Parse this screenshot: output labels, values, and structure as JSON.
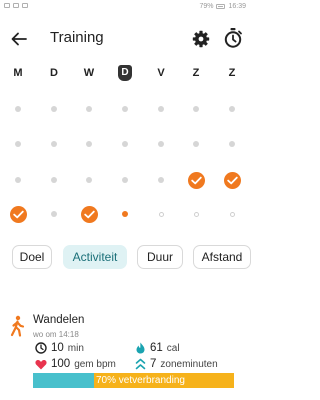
{
  "status_bar": {
    "left_icons": [
      "signal-icon",
      "wifi-icon",
      "bluetooth-icon"
    ],
    "battery": "79%",
    "time": "16:39"
  },
  "header": {
    "title": "Training",
    "icons": [
      "back-arrow-icon",
      "gear-icon",
      "stopwatch-icon"
    ]
  },
  "week_days": [
    {
      "label": "M",
      "current": false
    },
    {
      "label": "D",
      "current": false
    },
    {
      "label": "W",
      "current": false
    },
    {
      "label": "D",
      "current": true
    },
    {
      "label": "V",
      "current": false
    },
    {
      "label": "Z",
      "current": false
    },
    {
      "label": "Z",
      "current": false
    }
  ],
  "goal_grid": [
    [
      "none",
      "none",
      "none",
      "none",
      "none",
      "none",
      "none"
    ],
    [
      "none",
      "none",
      "none",
      "none",
      "none",
      "none",
      "none"
    ],
    [
      "none",
      "none",
      "none",
      "none",
      "none",
      "done",
      "done"
    ],
    [
      "done",
      "none",
      "done",
      "partial",
      "empty",
      "empty",
      "empty"
    ]
  ],
  "tabs": [
    {
      "label": "Doel",
      "active": false
    },
    {
      "label": "Activiteit",
      "active": true
    },
    {
      "label": "Duur",
      "active": false
    },
    {
      "label": "Afstand",
      "active": false
    }
  ],
  "activity": {
    "name": "Wandelen",
    "time": "wo om 14:18",
    "duration_value": "10",
    "duration_unit": "min",
    "calories_value": "61",
    "calories_unit": "cal",
    "heart_value": "100",
    "heart_unit": "gem bpm",
    "zone_value": "7",
    "zone_unit": "zoneminuten",
    "fat_burn_label": "70% vetverbranding"
  },
  "colors": {
    "accent": "#f0791f",
    "teal": "#48c0cc",
    "yellow": "#f6b21b",
    "heart": "#e8344e",
    "chip_active": "#dff2f4"
  }
}
